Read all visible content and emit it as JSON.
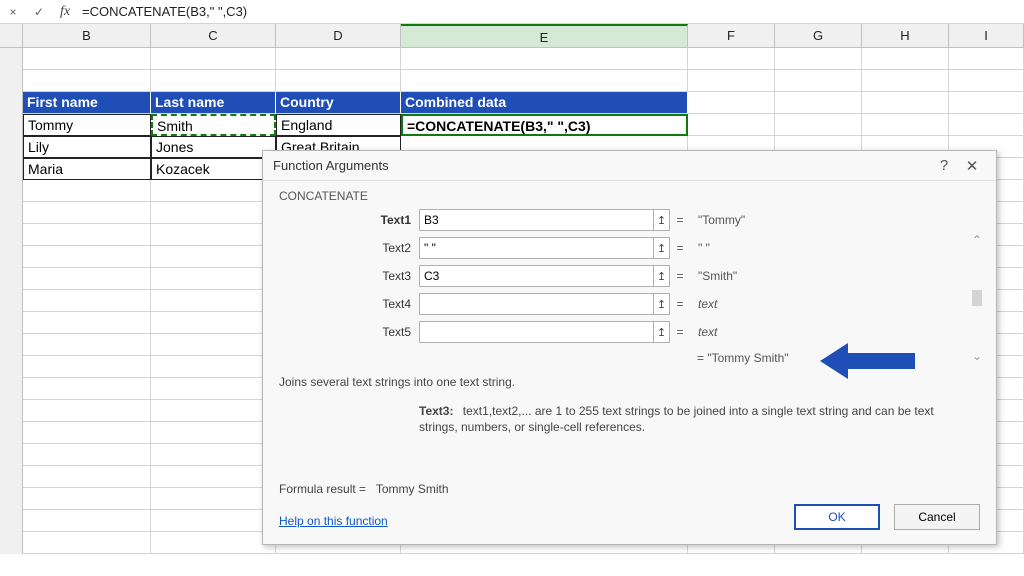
{
  "formula_bar": {
    "formula": "=CONCATENATE(B3,\" \",C3)",
    "buttons": {
      "cancel": "×",
      "enter": "✓",
      "fx": "fx"
    }
  },
  "columns": [
    "B",
    "C",
    "D",
    "E",
    "F",
    "G",
    "H",
    "I"
  ],
  "selected_column": "E",
  "headers": {
    "B": "First name",
    "C": "Last name",
    "D": "Country",
    "E": "Combined data"
  },
  "rows": [
    {
      "B": "Tommy",
      "C": "Smith",
      "D": "England",
      "E": "=CONCATENATE(B3,\" \",C3)"
    },
    {
      "B": "Lily",
      "C": "Jones",
      "D": "Great Britain",
      "E": ""
    },
    {
      "B": "Maria",
      "C": "Kozacek",
      "D": "",
      "E": ""
    }
  ],
  "dialog": {
    "title": "Function Arguments",
    "help_glyph": "?",
    "close_glyph": "✕",
    "fn": "CONCATENATE",
    "args": [
      {
        "label": "Text1",
        "bold": true,
        "value": "B3",
        "preview": "\"Tommy\""
      },
      {
        "label": "Text2",
        "bold": false,
        "value": "\" \"",
        "preview": "\" \""
      },
      {
        "label": "Text3",
        "bold": false,
        "value": "C3",
        "preview": "\"Smith\""
      },
      {
        "label": "Text4",
        "bold": false,
        "value": "",
        "preview": "text",
        "italic": true
      },
      {
        "label": "Text5",
        "bold": false,
        "value": "",
        "preview": "text",
        "italic": true
      }
    ],
    "ref_glyph": "↥",
    "result_preview": "= \"Tommy Smith\"",
    "description": "Joins several text strings into one text string.",
    "hint_label": "Text3:",
    "hint_body": "text1,text2,... are 1 to 255 text strings to be joined into a single text string and can be text strings, numbers, or single-cell references.",
    "formula_result_label": "Formula result =",
    "formula_result_value": "Tommy Smith",
    "help_link": "Help on this function",
    "ok": "OK",
    "cancel": "Cancel"
  }
}
